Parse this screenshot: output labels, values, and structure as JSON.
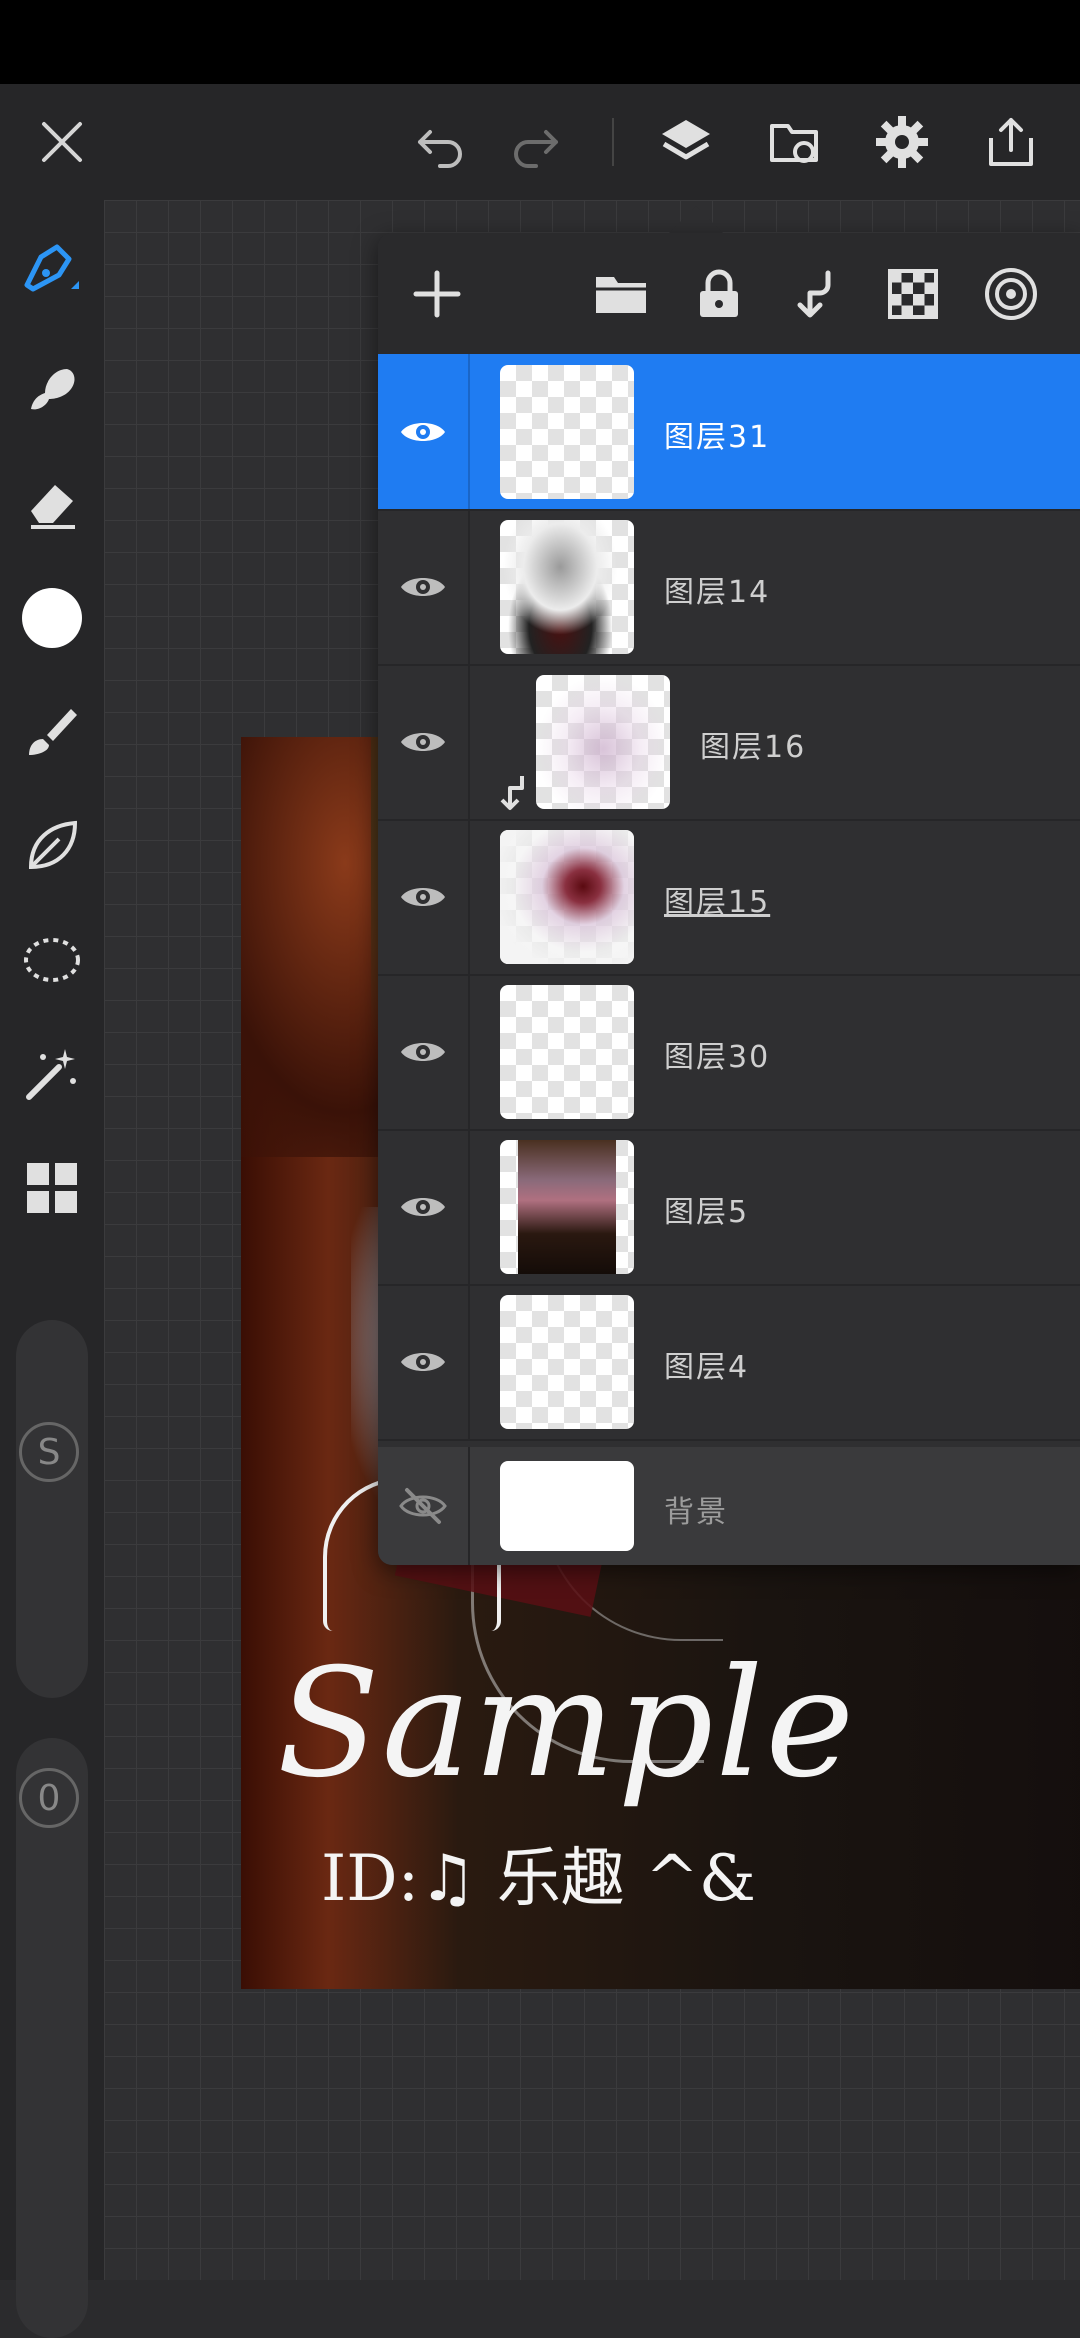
{
  "toolbar": {
    "close_icon": "close-icon",
    "undo_icon": "undo-icon",
    "redo_icon": "redo-icon",
    "layers_icon": "layers-icon",
    "gallery_icon": "gallery-icon",
    "settings_icon": "gear-icon",
    "share_icon": "share-icon"
  },
  "left_tools": [
    "pen-brush-icon",
    "smudge-icon",
    "eraser-icon",
    "color-swatch",
    "paint-brush-icon",
    "leaf-icon",
    "lasso-selection-icon",
    "magic-wand-icon",
    "more-tools-icon"
  ],
  "sliders": {
    "size_label": "S",
    "opacity_label": "0"
  },
  "accent_color": "#1f7cf2",
  "layers_panel": {
    "actions": [
      "add-layer-icon",
      "folder-icon",
      "lock-icon",
      "clip-mask-icon",
      "transparency-lock-icon",
      "blend-mode-icon"
    ],
    "layers": [
      {
        "name": "图层31",
        "visible": true,
        "selected": true
      },
      {
        "name": "图层14",
        "visible": true
      },
      {
        "name": "图层16",
        "visible": true,
        "clipped": true
      },
      {
        "name": "图层15",
        "visible": true
      },
      {
        "name": "图层30",
        "visible": true
      },
      {
        "name": "图层5",
        "visible": true
      },
      {
        "name": "图层4",
        "visible": true
      }
    ],
    "background": {
      "name": "背景",
      "visible": false
    }
  },
  "artwork": {
    "watermark_text": "Sample",
    "id_text": "ID:♫ 乐趣 ^&"
  }
}
